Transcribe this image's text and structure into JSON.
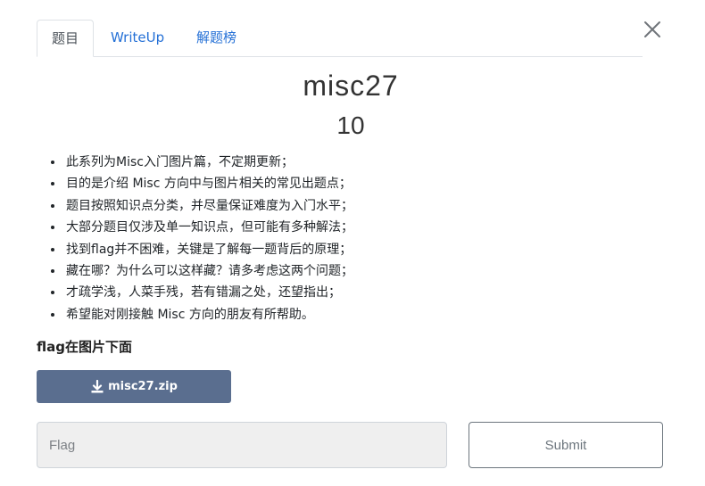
{
  "tabs": [
    {
      "label": "题目",
      "active": true
    },
    {
      "label": "WriteUp",
      "active": false
    },
    {
      "label": "解题榜",
      "active": false
    }
  ],
  "challenge": {
    "name": "misc27",
    "points": "10",
    "description": [
      "此系列为Misc入门图片篇，不定期更新；",
      "目的是介绍 Misc 方向中与图片相关的常见出题点；",
      "题目按照知识点分类，并尽量保证难度为入门水平；",
      "大部分题目仅涉及单一知识点，但可能有多种解法；",
      "找到flag并不困难，关键是了解每一题背后的原理；",
      "藏在哪？为什么可以这样藏？请多考虑这两个问题；",
      "才疏学浅，人菜手残，若有错漏之处，还望指出；",
      "希望能对刚接触 Misc 方向的朋友有所帮助。"
    ],
    "hint": "flag在图片下面",
    "file_label": "misc27.zip"
  },
  "form": {
    "flag_placeholder": "Flag",
    "flag_value": "",
    "submit_label": "Submit"
  },
  "icons": {
    "close": "close-icon",
    "download": "download-icon"
  },
  "colors": {
    "link": "#2470d6",
    "download_button": "#5a6e8f",
    "input_bg": "#efefef"
  }
}
